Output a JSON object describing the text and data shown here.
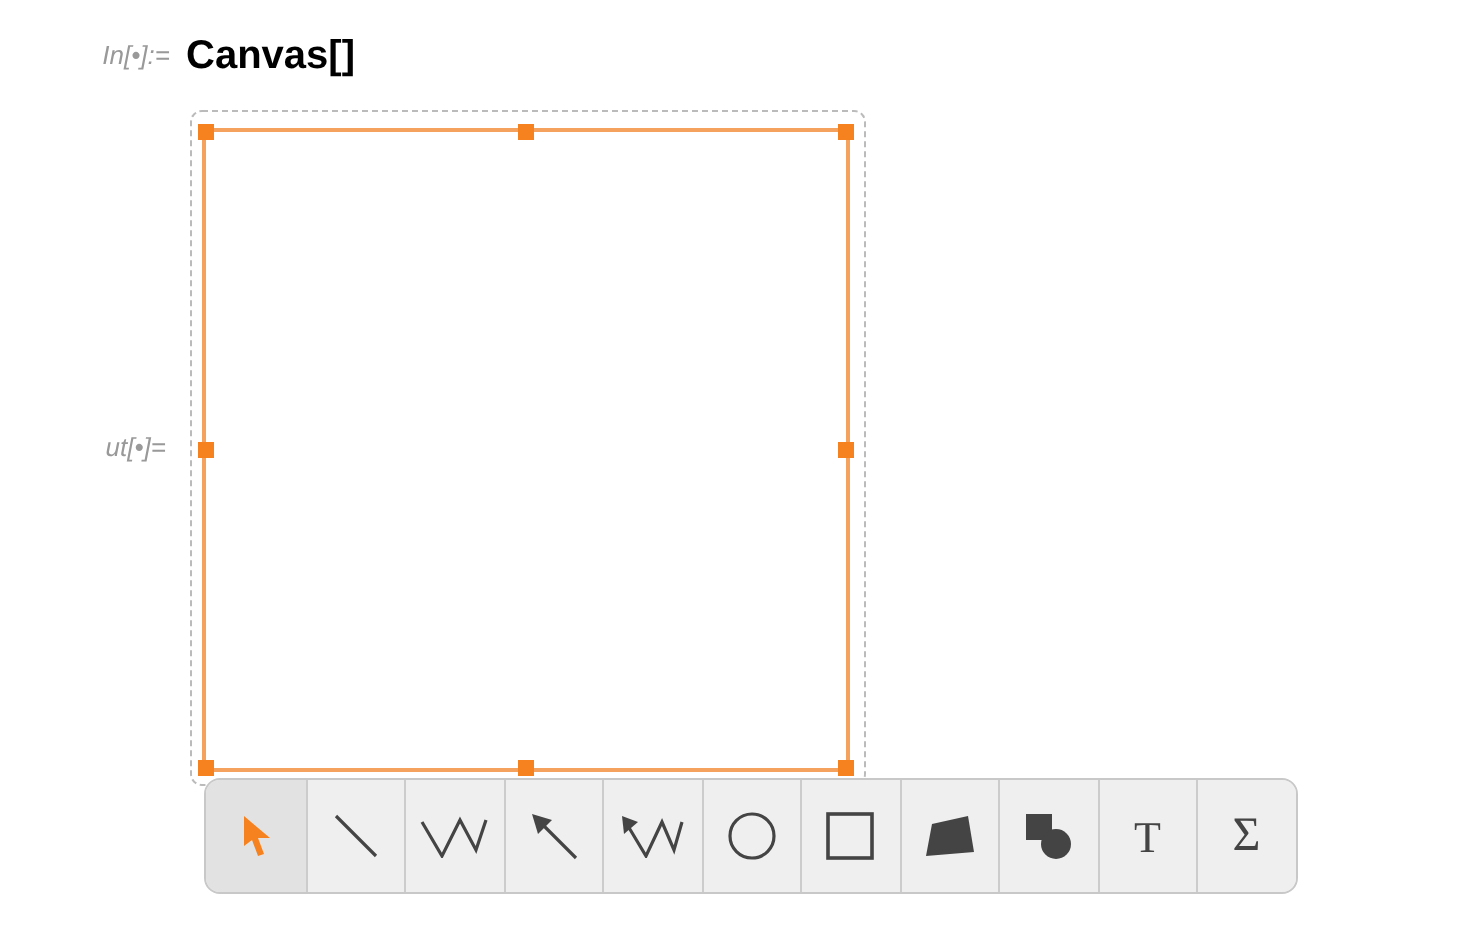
{
  "input": {
    "label": "In[•]:=",
    "code": "Canvas[]"
  },
  "output": {
    "label": "ut[•]="
  },
  "toolbar": [
    {
      "kind": "select",
      "selected": true
    },
    {
      "kind": "line",
      "selected": false
    },
    {
      "kind": "polyline",
      "selected": false
    },
    {
      "kind": "arrow",
      "selected": false
    },
    {
      "kind": "polyarrow",
      "selected": false
    },
    {
      "kind": "circle",
      "selected": false
    },
    {
      "kind": "rectangle",
      "selected": false
    },
    {
      "kind": "polygon",
      "selected": false
    },
    {
      "kind": "shapes",
      "selected": false
    },
    {
      "kind": "text",
      "label": "T",
      "selected": false
    },
    {
      "kind": "math",
      "label": "Σ",
      "selected": false
    }
  ]
}
